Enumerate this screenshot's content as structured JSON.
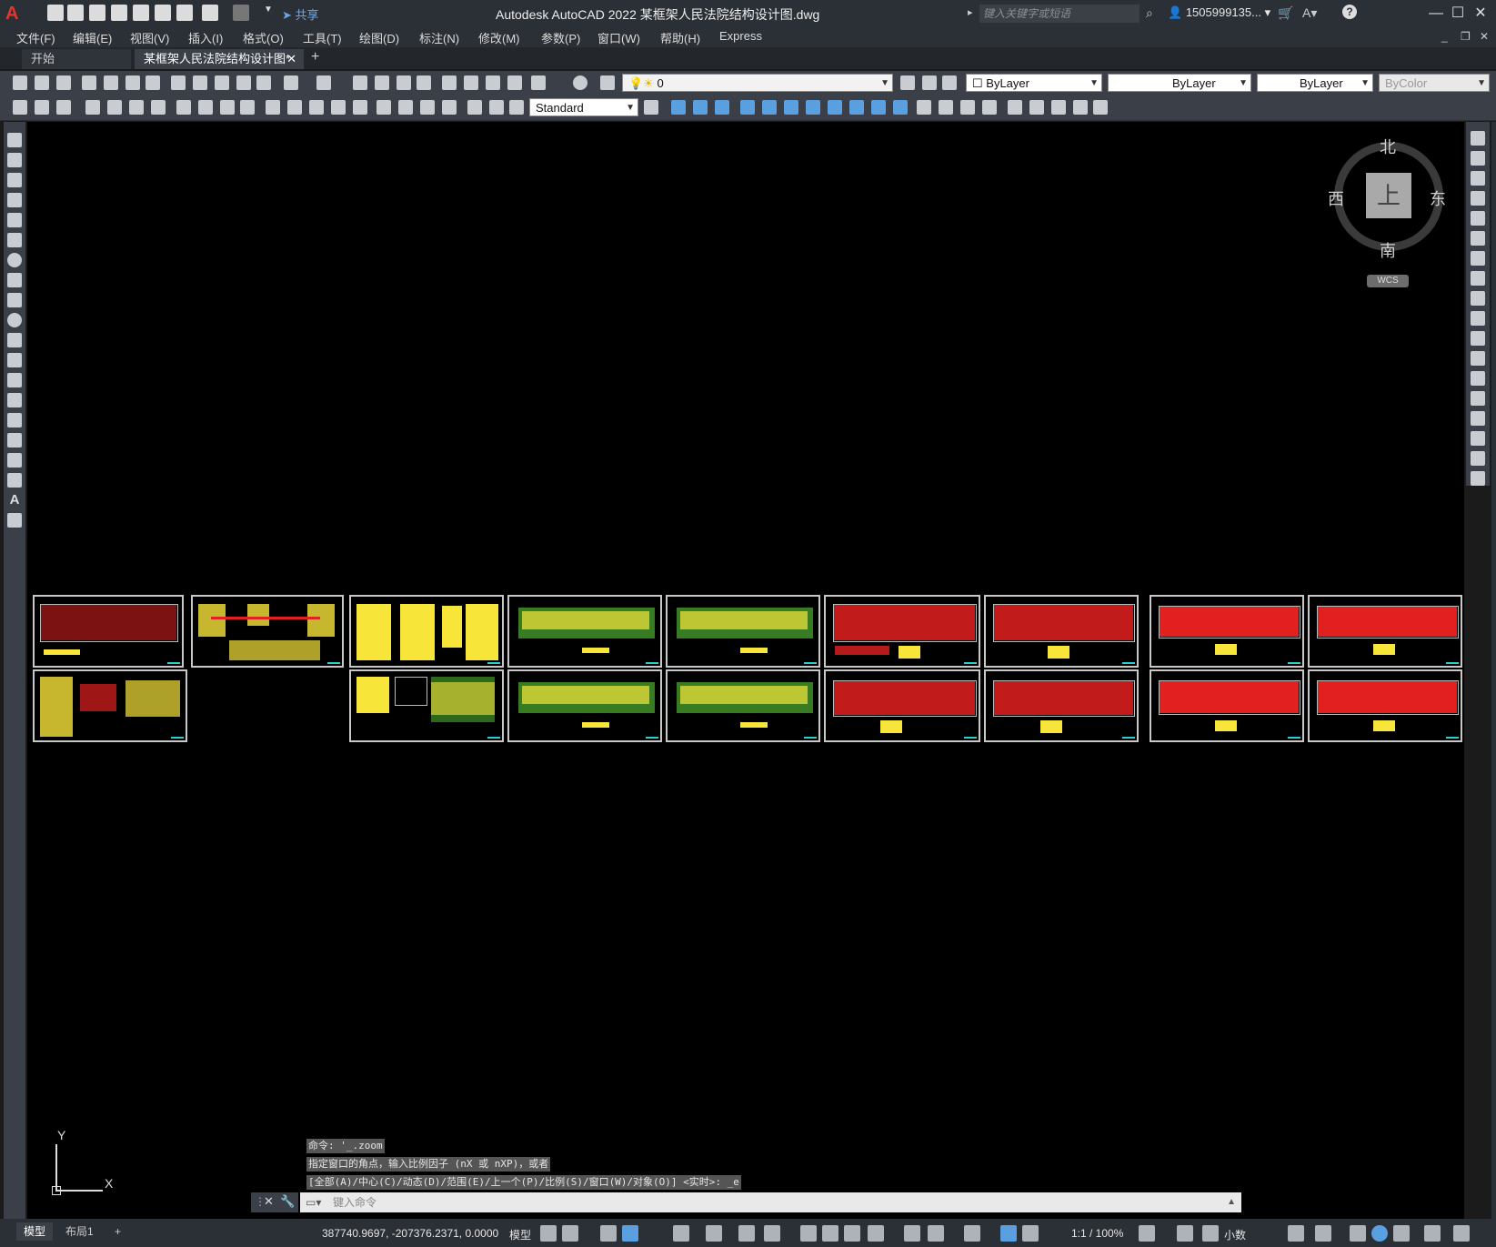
{
  "app": {
    "title": "Autodesk AutoCAD 2022    某框架人民法院结构设计图.dwg",
    "logo": "A",
    "share_label": "共享",
    "search_placeholder": "键入关键字或短语",
    "user": "1505999135...",
    "help": "?"
  },
  "window_controls": {
    "minimize": "—",
    "maximize": "☐",
    "close": "✕"
  },
  "menu": [
    "文件(F)",
    "编辑(E)",
    "视图(V)",
    "插入(I)",
    "格式(O)",
    "工具(T)",
    "绘图(D)",
    "标注(N)",
    "修改(M)",
    "参数(P)",
    "窗口(W)",
    "帮助(H)",
    "Express"
  ],
  "tabs": {
    "start": "开始",
    "document": "某框架人民法院结构设计图*",
    "close": "✕",
    "add": "+"
  },
  "toolbar": {
    "layer": "0",
    "color": "ByLayer",
    "linetype": "ByLayer",
    "lineweight": "ByLayer",
    "plotstyle": "ByColor",
    "textstyle": "Standard"
  },
  "viewcube": {
    "north": "北",
    "south": "南",
    "east": "东",
    "west": "西",
    "face": "上",
    "wcs": "WCS"
  },
  "ucs": {
    "y": "Y",
    "x": "X"
  },
  "command": {
    "history": [
      "命令: '_.zoom",
      "指定窗口的角点，输入比例因子 (nX 或 nXP)，或者",
      "[全部(A)/中心(C)/动态(D)/范围(E)/上一个(P)/比例(S)/窗口(W)/对象(O)] <实时>: _e"
    ],
    "placeholder": "键入命令"
  },
  "statusbar": {
    "model_tab": "模型",
    "layout_tab": "布局1",
    "add": "+",
    "coords": "387740.9697, -207376.2371, 0.0000",
    "model": "模型",
    "scale": "1:1 / 100%",
    "units": "小数"
  },
  "colors": {
    "canvas": "#000000",
    "sheet_border": "#c8c8c8",
    "yellow_text": "#f7e53a",
    "red_rebar": "#e32020",
    "green_axis": "#5bcf3a",
    "cyan_accent": "#29d0d0"
  }
}
